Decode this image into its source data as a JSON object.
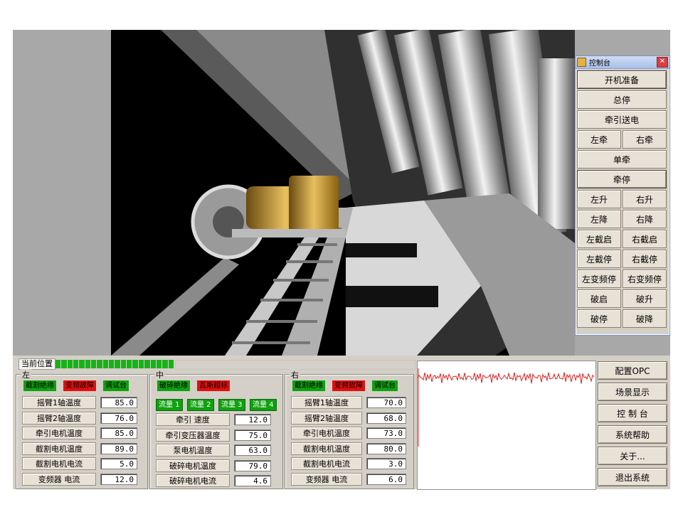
{
  "console": {
    "title": "控制台",
    "buttons": [
      "开机准备",
      "总停",
      "牵引送电",
      "左牵",
      "右牵",
      "单牵",
      "牵停",
      "左升",
      "右升",
      "左降",
      "右降",
      "左截启",
      "右截启",
      "左截停",
      "右截停",
      "左变频停",
      "右变频停",
      "破启",
      "破升",
      "破停",
      "破降"
    ]
  },
  "position": {
    "label": "当前位置",
    "segments": 20
  },
  "left": {
    "title": "左",
    "indicators": [
      {
        "text": "截割绝缘",
        "color": "#10a010"
      },
      {
        "text": "变频故障",
        "color": "#e01010"
      },
      {
        "text": "调试台",
        "color": "#10a010"
      }
    ],
    "rows": [
      {
        "label": "摇臂1轴温度",
        "value": "85.0"
      },
      {
        "label": "摇臂2轴温度",
        "value": "76.0"
      },
      {
        "label": "牵引电机温度",
        "value": "85.0"
      },
      {
        "label": "截割电机温度",
        "value": "89.0"
      },
      {
        "label": "截割电机电流",
        "value": "5.0"
      },
      {
        "label": "变频器  电流",
        "value": "12.0"
      }
    ]
  },
  "middle": {
    "title": "中",
    "indicators": [
      {
        "text": "破碎绝缘",
        "color": "#10a010"
      },
      {
        "text": "瓦斯超标",
        "color": "#e01010"
      }
    ],
    "flows": [
      "流量 1",
      "流量 2",
      "流量 3",
      "流量 4"
    ],
    "rows": [
      {
        "label": "牵引  速度",
        "value": "12.0"
      },
      {
        "label": "牵引变压器温度",
        "value": "75.0"
      },
      {
        "label": "泵电机温度",
        "value": "63.0"
      },
      {
        "label": "破碎电机温度",
        "value": "79.0"
      },
      {
        "label": "破碎电机电流",
        "value": "4.6"
      }
    ]
  },
  "right": {
    "title": "右",
    "indicators": [
      {
        "text": "截割绝缘",
        "color": "#10a010"
      },
      {
        "text": "变频故障",
        "color": "#e01010"
      },
      {
        "text": "调试台",
        "color": "#10a010"
      }
    ],
    "rows": [
      {
        "label": "摇臂1轴温度",
        "value": "70.0"
      },
      {
        "label": "摇臂2轴温度",
        "value": "68.0"
      },
      {
        "label": "牵引电机温度",
        "value": "73.0"
      },
      {
        "label": "截割电机温度",
        "value": "80.0"
      },
      {
        "label": "截割电机电流",
        "value": "3.0"
      },
      {
        "label": "变频器  电流",
        "value": "6.0"
      }
    ]
  },
  "side_buttons": [
    "配置OPC",
    "场景显示",
    "控 制 台",
    "系统帮助",
    "关于...",
    "退出系统"
  ],
  "colors": {
    "ok": "#10a010",
    "alarm": "#e01010",
    "progress": "#17b217",
    "wave": "#e02020"
  }
}
